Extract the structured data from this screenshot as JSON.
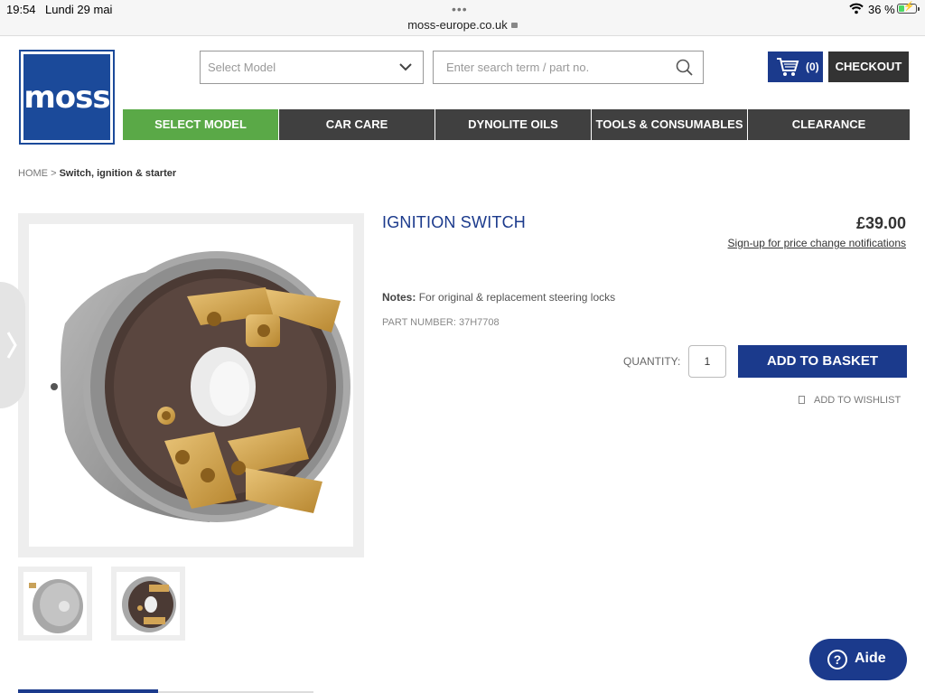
{
  "status_bar": {
    "time": "19:54",
    "date": "Lundi 29 mai",
    "url": "moss-europe.co.uk",
    "battery": "36 %",
    "battery_level": 0.36
  },
  "header": {
    "logo_text": "moss",
    "select_model_label": "Select Model",
    "search_placeholder": "Enter search term / part no.",
    "cart_count": "(0)",
    "checkout_label": "CHECKOUT"
  },
  "nav": [
    {
      "label": "SELECT MODEL"
    },
    {
      "label": "CAR CARE"
    },
    {
      "label": "DYNOLITE OILS"
    },
    {
      "label": "TOOLS & CONSUMABLES"
    },
    {
      "label": "CLEARANCE"
    }
  ],
  "breadcrumb": {
    "home": "HOME",
    "separator": ">",
    "current": "Switch, ignition & starter"
  },
  "product": {
    "title": "IGNITION SWITCH",
    "price": "£39.00",
    "price_signup": "Sign-up for price change notifications",
    "notes_label": "Notes:",
    "notes_text": "For original & replacement steering locks",
    "part_number": "PART NUMBER: 37H7708",
    "quantity_label": "QUANTITY:",
    "quantity_value": "1",
    "add_to_basket": "ADD TO BASKET",
    "add_to_wishlist": "ADD TO WISHLIST"
  },
  "help": {
    "label": "Aide"
  },
  "colors": {
    "brand_blue": "#1b3a8c",
    "nav_green": "#5aa947",
    "nav_dark": "#404040"
  }
}
